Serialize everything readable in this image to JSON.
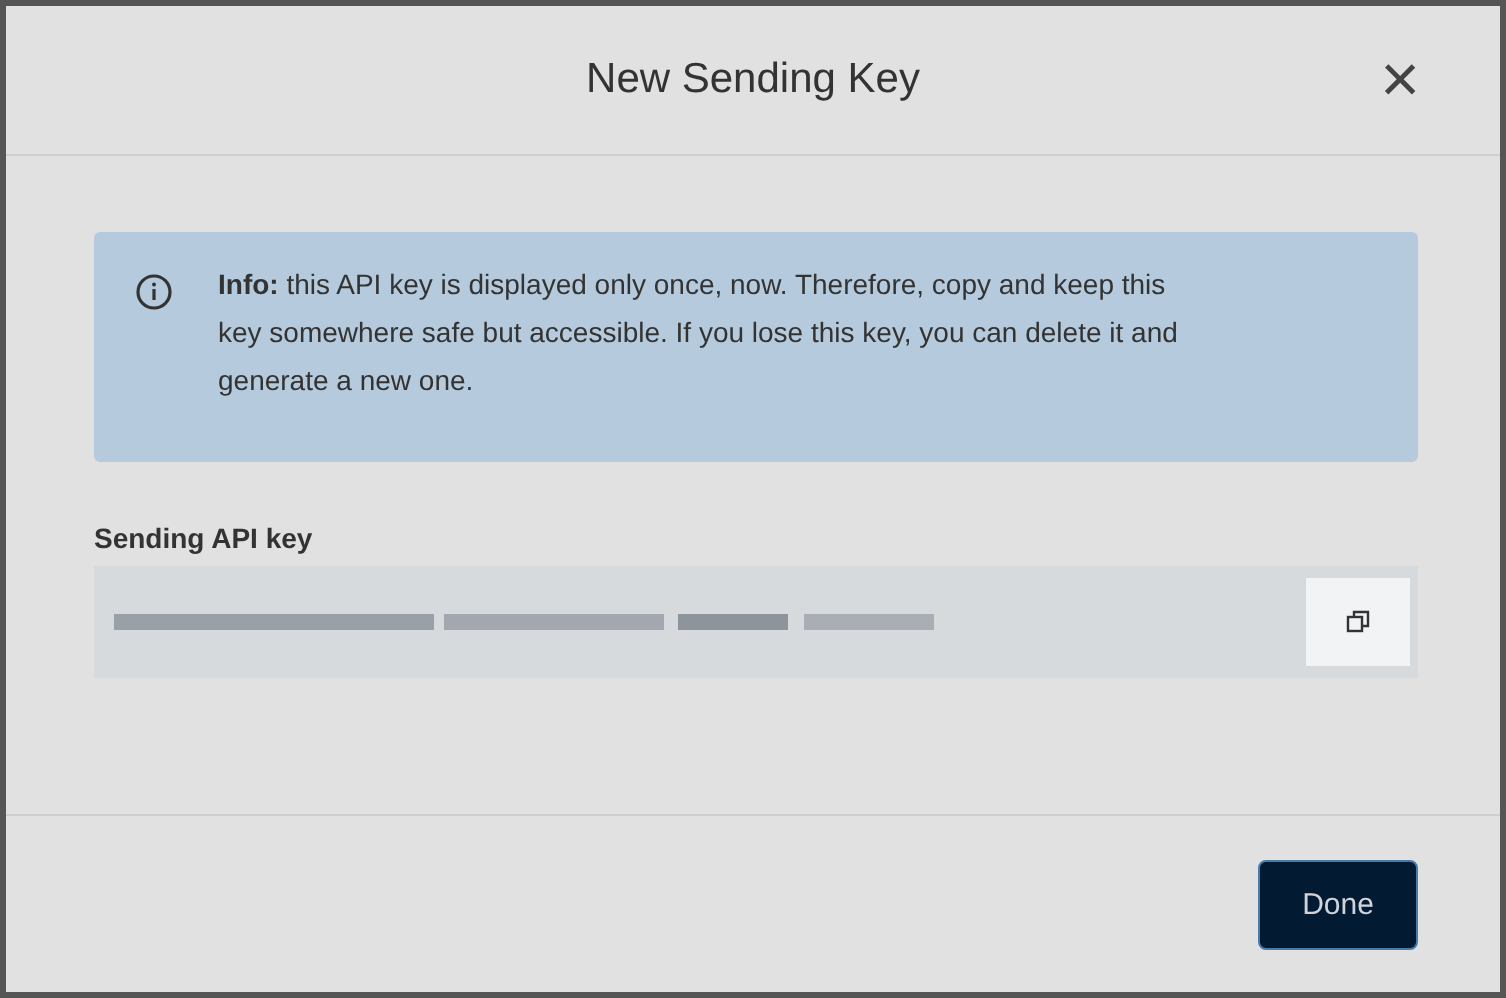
{
  "dialog": {
    "title": "New Sending Key",
    "close": "×"
  },
  "info": {
    "text": "**Info:** this API key is displayed only once, now. Therefore, copy and keep this key somewhere safe but accessible. If you lose this key, you can delete it and generate a new one."
  },
  "key_field": {
    "label": "Sending API key"
  },
  "buttons": [
    "Done"
  ]
}
